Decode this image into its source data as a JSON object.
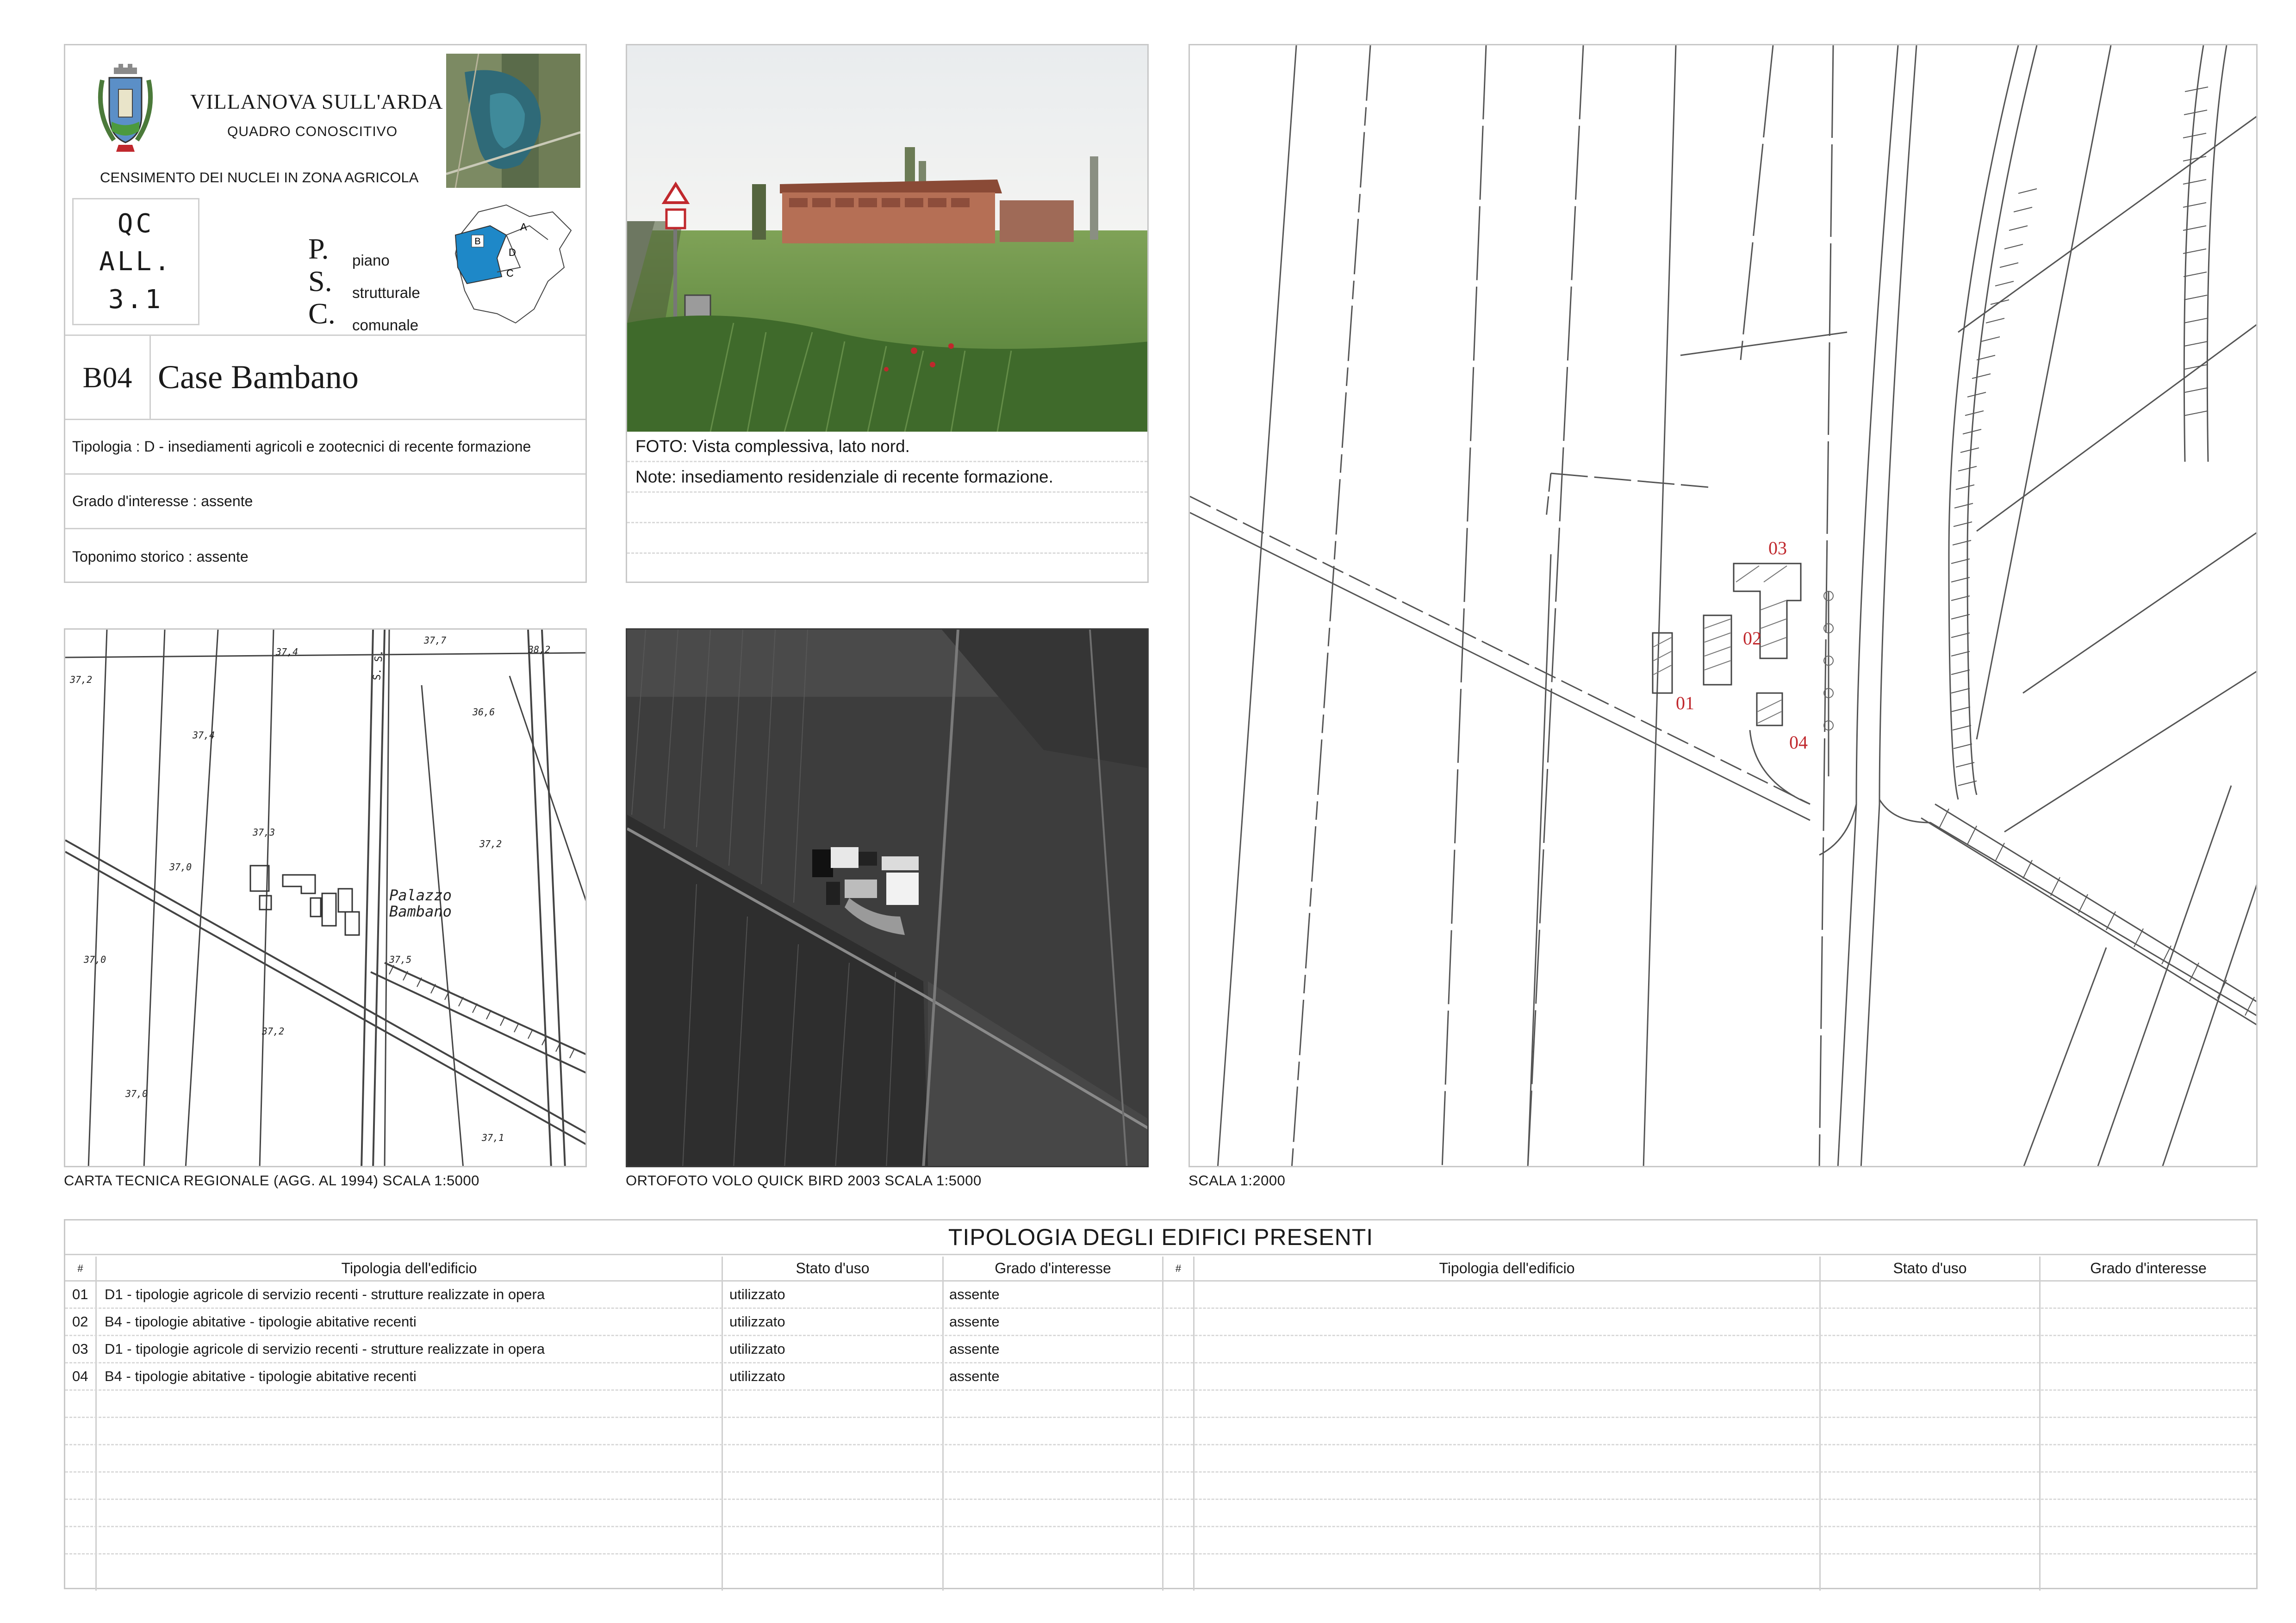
{
  "header": {
    "municipality": "VILLANOVA SULL'ARDA",
    "subtitle": "QUADRO CONOSCITIVO",
    "census": "CENSIMENTO DEI NUCLEI IN ZONA AGRICOLA",
    "qc_lines": [
      "QC",
      "ALL.",
      "3.1"
    ],
    "psc_letters": [
      "P.",
      "S.",
      "C."
    ],
    "psc_words": [
      "piano",
      "strutturale",
      "comunale"
    ],
    "zone_labels": [
      "A",
      "B",
      "C",
      "D"
    ],
    "code": "B04",
    "name": "Case Bambano",
    "tipologia": "Tipologia : D - insediamenti agricoli e zootecnici di recente formazione",
    "grado": "Grado d'interesse : assente",
    "toponimo": "Toponimo storico : assente"
  },
  "photo": {
    "caption": "FOTO: Vista complessiva, lato nord.",
    "note": "Note: insediamento residenziale di recente formazione."
  },
  "ctr_map": {
    "caption": "CARTA TECNICA REGIONALE (AGG. AL 1994) SCALA 1:5000",
    "label_palazzo": "Palazzo",
    "label_bambano": "Bambano",
    "label_road": "S. S.",
    "elevations": [
      "37,2",
      "37,4",
      "37,7",
      "38,2",
      "37,4",
      "36,6",
      "37,3",
      "37,0",
      "37,2",
      "37,0",
      "37,5",
      "37,2",
      "37,0",
      "37,1"
    ]
  },
  "ortho_map": {
    "caption": "ORTOFOTO VOLO QUICK BIRD 2003 SCALA 1:5000"
  },
  "plan_map": {
    "caption": "SCALA 1:2000",
    "labels": [
      "01",
      "02",
      "03",
      "04"
    ],
    "label_color": "#c0282d"
  },
  "table": {
    "title": "TIPOLOGIA DEGLI EDIFICI PRESENTI",
    "headers": {
      "num": "#",
      "typology": "Tipologia dell'edificio",
      "status": "Stato d'uso",
      "grade": "Grado d'interesse"
    },
    "rows": [
      {
        "num": "01",
        "typology": "D1 - tipologie agricole di servizio recenti - strutture realizzate in opera",
        "status": "utilizzato",
        "grade": "assente"
      },
      {
        "num": "02",
        "typology": "B4 - tipologie abitative - tipologie abitative recenti",
        "status": "utilizzato",
        "grade": "assente"
      },
      {
        "num": "03",
        "typology": "D1 - tipologie agricole di servizio recenti - strutture realizzate in opera",
        "status": "utilizzato",
        "grade": "assente"
      },
      {
        "num": "04",
        "typology": "B4 - tipologie abitative - tipologie abitative recenti",
        "status": "utilizzato",
        "grade": "assente"
      }
    ]
  },
  "colors": {
    "zone_highlight": "#1e88c8",
    "label_red": "#c0282d",
    "border": "#c8c8c8"
  }
}
